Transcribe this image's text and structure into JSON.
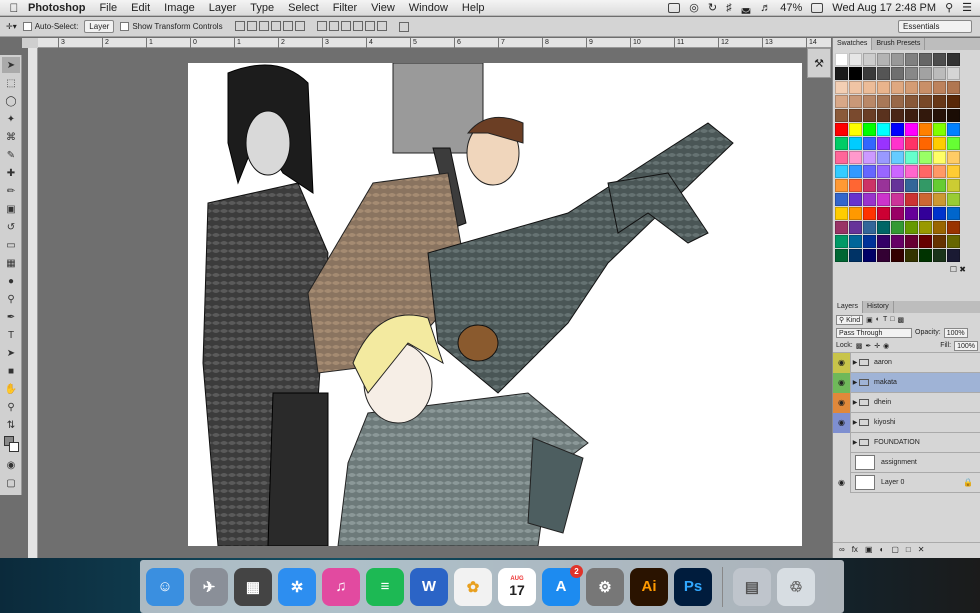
{
  "menubar": {
    "app": "Photoshop",
    "items": [
      "File",
      "Edit",
      "Image",
      "Layer",
      "Type",
      "Select",
      "Filter",
      "View",
      "Window",
      "Help"
    ],
    "battery": "47%",
    "datetime": "Wed Aug 17  2:48 PM"
  },
  "options": {
    "auto_select_label": "Auto-Select:",
    "auto_select_value": "Layer",
    "transform_label": "Show Transform Controls",
    "workspace": "Essentials"
  },
  "ruler": {
    "ticks": [
      "3",
      "2",
      "1",
      "0",
      "1",
      "2",
      "3",
      "4",
      "5",
      "6",
      "7",
      "8",
      "9",
      "10",
      "11",
      "12",
      "13",
      "14"
    ]
  },
  "swatches": {
    "tabs": [
      "Swatches",
      "Brush Presets"
    ],
    "colors": [
      "#ffffff",
      "#e6e6e6",
      "#cccccc",
      "#b3b3b3",
      "#999999",
      "#808080",
      "#666666",
      "#4d4d4d",
      "#333333",
      "#1a1a1a",
      "#000000",
      "#3a3a3a",
      "#555555",
      "#6f6f6f",
      "#888888",
      "#a2a2a2",
      "#bbbbbb",
      "#d5d5d5",
      "#f3cfb4",
      "#f0c4a4",
      "#ecbc98",
      "#e9b48c",
      "#dfa880",
      "#d49c74",
      "#c98f68",
      "#bd825c",
      "#b07650",
      "#d8a888",
      "#c99878",
      "#b98868",
      "#a87858",
      "#986848",
      "#885838",
      "#784828",
      "#683818",
      "#582808",
      "#8a5a3a",
      "#7a4a2e",
      "#6a3e26",
      "#5a321e",
      "#4a2616",
      "#3e1e10",
      "#32180c",
      "#261208",
      "#1a0c04",
      "#ff0000",
      "#ffff00",
      "#00ff00",
      "#00ffff",
      "#0000ff",
      "#ff00ff",
      "#ff8000",
      "#80ff00",
      "#0080ff",
      "#00cc66",
      "#00ccff",
      "#3366ff",
      "#9933ff",
      "#ff33cc",
      "#ff3366",
      "#ff6600",
      "#ffcc00",
      "#66ff33",
      "#ff6699",
      "#ff99cc",
      "#cc99ff",
      "#9999ff",
      "#66ccff",
      "#66ffcc",
      "#99ff66",
      "#ffff66",
      "#ffcc66",
      "#33ccff",
      "#3399ff",
      "#6666ff",
      "#9966ff",
      "#cc66ff",
      "#ff66cc",
      "#ff6666",
      "#ff9966",
      "#ffcc33",
      "#ff9933",
      "#ff6633",
      "#cc3366",
      "#993399",
      "#663399",
      "#336699",
      "#339966",
      "#66cc33",
      "#cccc33",
      "#3366cc",
      "#6633cc",
      "#9933cc",
      "#cc33cc",
      "#cc3399",
      "#cc3333",
      "#cc6633",
      "#cc9933",
      "#99cc33",
      "#ffcc00",
      "#ff9900",
      "#ff3300",
      "#cc0033",
      "#990066",
      "#660099",
      "#330099",
      "#0033cc",
      "#0066cc",
      "#993366",
      "#663399",
      "#336699",
      "#006666",
      "#339933",
      "#669900",
      "#999900",
      "#996600",
      "#993300",
      "#009966",
      "#006699",
      "#003399",
      "#330066",
      "#660066",
      "#660033",
      "#660000",
      "#663300",
      "#666600",
      "#006633",
      "#003366",
      "#000066",
      "#330033",
      "#330000",
      "#333300",
      "#003300",
      "#1a331a",
      "#1a1a33"
    ],
    "footer": "☐ ✖"
  },
  "layers": {
    "tabs": [
      "Layers",
      "History"
    ],
    "kind": "Kind",
    "blend": "Pass Through",
    "opacity_label": "Opacity:",
    "opacity": "100%",
    "lock_label": "Lock:",
    "fill_label": "Fill:",
    "fill": "100%",
    "rows": [
      {
        "name": "aaron",
        "eye": "◉",
        "eye_bg": "#c8c44a",
        "type": "group",
        "active": false
      },
      {
        "name": "makata",
        "eye": "◉",
        "eye_bg": "#6fb85a",
        "type": "group",
        "active": true
      },
      {
        "name": "dhein",
        "eye": "◉",
        "eye_bg": "#e0883a",
        "type": "group",
        "active": false
      },
      {
        "name": "kiyoshi",
        "eye": "◉",
        "eye_bg": "#7e8fd0",
        "type": "group",
        "active": false
      },
      {
        "name": "FOUNDATION",
        "eye": "",
        "eye_bg": "#d6d6d6",
        "type": "group",
        "active": false
      },
      {
        "name": "assignment",
        "eye": "",
        "eye_bg": "#d6d6d6",
        "type": "layer",
        "active": false
      },
      {
        "name": "Layer 0",
        "eye": "◉",
        "eye_bg": "#d6d6d6",
        "type": "layer",
        "active": false,
        "locked": true
      }
    ],
    "footer": [
      "∞",
      "fx",
      "▣",
      "◐",
      "▢",
      "□",
      "✕"
    ]
  },
  "dock": {
    "apps": [
      {
        "name": "finder-icon",
        "label": "☺",
        "bg": "#3a8fe0"
      },
      {
        "name": "launchpad-icon",
        "label": "✈",
        "bg": "#8a8f98"
      },
      {
        "name": "photo-booth-icon",
        "label": "▦",
        "bg": "#444"
      },
      {
        "name": "safari-icon",
        "label": "✲",
        "bg": "#2d8ef0"
      },
      {
        "name": "itunes-icon",
        "label": "♫",
        "bg": "#e24aa0"
      },
      {
        "name": "spotify-icon",
        "label": "≡",
        "bg": "#1db954"
      },
      {
        "name": "word-icon",
        "label": "W",
        "bg": "#2b64c6"
      },
      {
        "name": "photos-icon",
        "label": "✿",
        "bg": "#f2f2f2"
      },
      {
        "name": "calendar-icon",
        "label": "17",
        "bg": "#ffffff"
      },
      {
        "name": "app-store-icon",
        "label": "A",
        "bg": "#1d8bf0",
        "badge": "2"
      },
      {
        "name": "system-preferences-icon",
        "label": "⚙",
        "bg": "#777"
      },
      {
        "name": "illustrator-icon",
        "label": "Ai",
        "bg": "#2a1300"
      },
      {
        "name": "photoshop-icon",
        "label": "Ps",
        "bg": "#001c3d"
      }
    ],
    "calendar_month": "AUG",
    "trash": "♲",
    "downloads": "▤"
  }
}
